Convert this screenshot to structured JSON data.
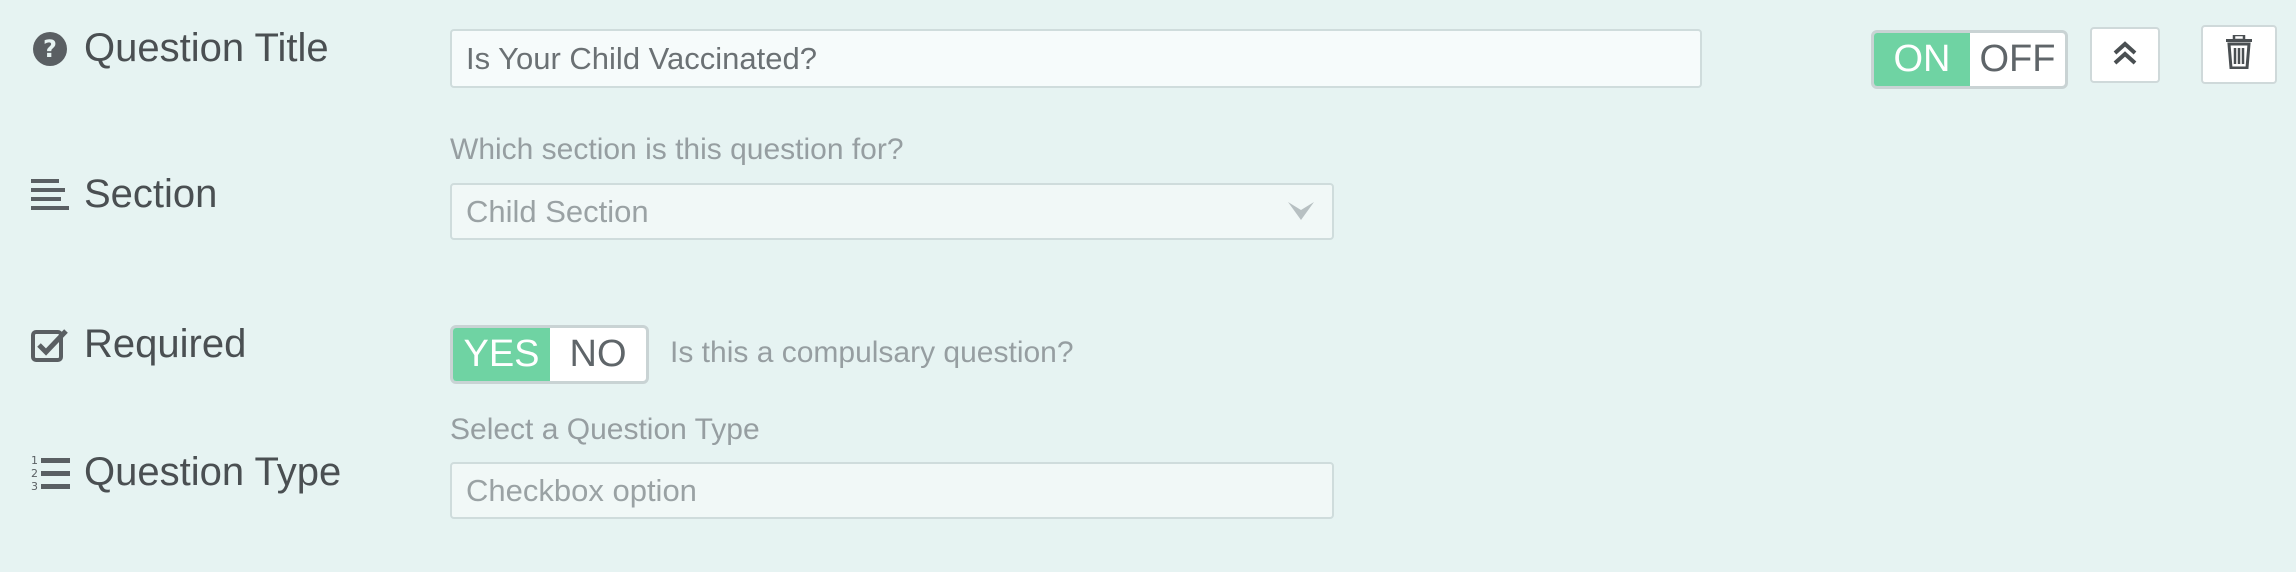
{
  "question_title": {
    "label": "Question Title",
    "icon": "question-circle-icon",
    "value": "Is Your Child Vaccinated?",
    "toggle": {
      "on_label": "ON",
      "off_label": "OFF",
      "selected": "ON"
    },
    "collapse_icon": "double-chevron-up-icon",
    "delete_icon": "trash-icon"
  },
  "section": {
    "label": "Section",
    "icon": "align-left-icon",
    "help": "Which section is this question for?",
    "selected": "Child Section",
    "caret_icon": "chevron-down-icon"
  },
  "required": {
    "label": "Required",
    "icon": "checkbox-checked-icon",
    "toggle": {
      "yes_label": "YES",
      "no_label": "NO",
      "selected": "YES"
    },
    "help": "Is this a compulsary question?"
  },
  "question_type": {
    "label": "Question Type",
    "icon": "numbered-list-icon",
    "help": "Select a Question Type",
    "value": "Checkbox option"
  },
  "colors": {
    "background": "#e6f3f2",
    "accent_green": "#6fd3a3",
    "label_text": "#4a4f52",
    "muted_text": "#969ea1"
  }
}
